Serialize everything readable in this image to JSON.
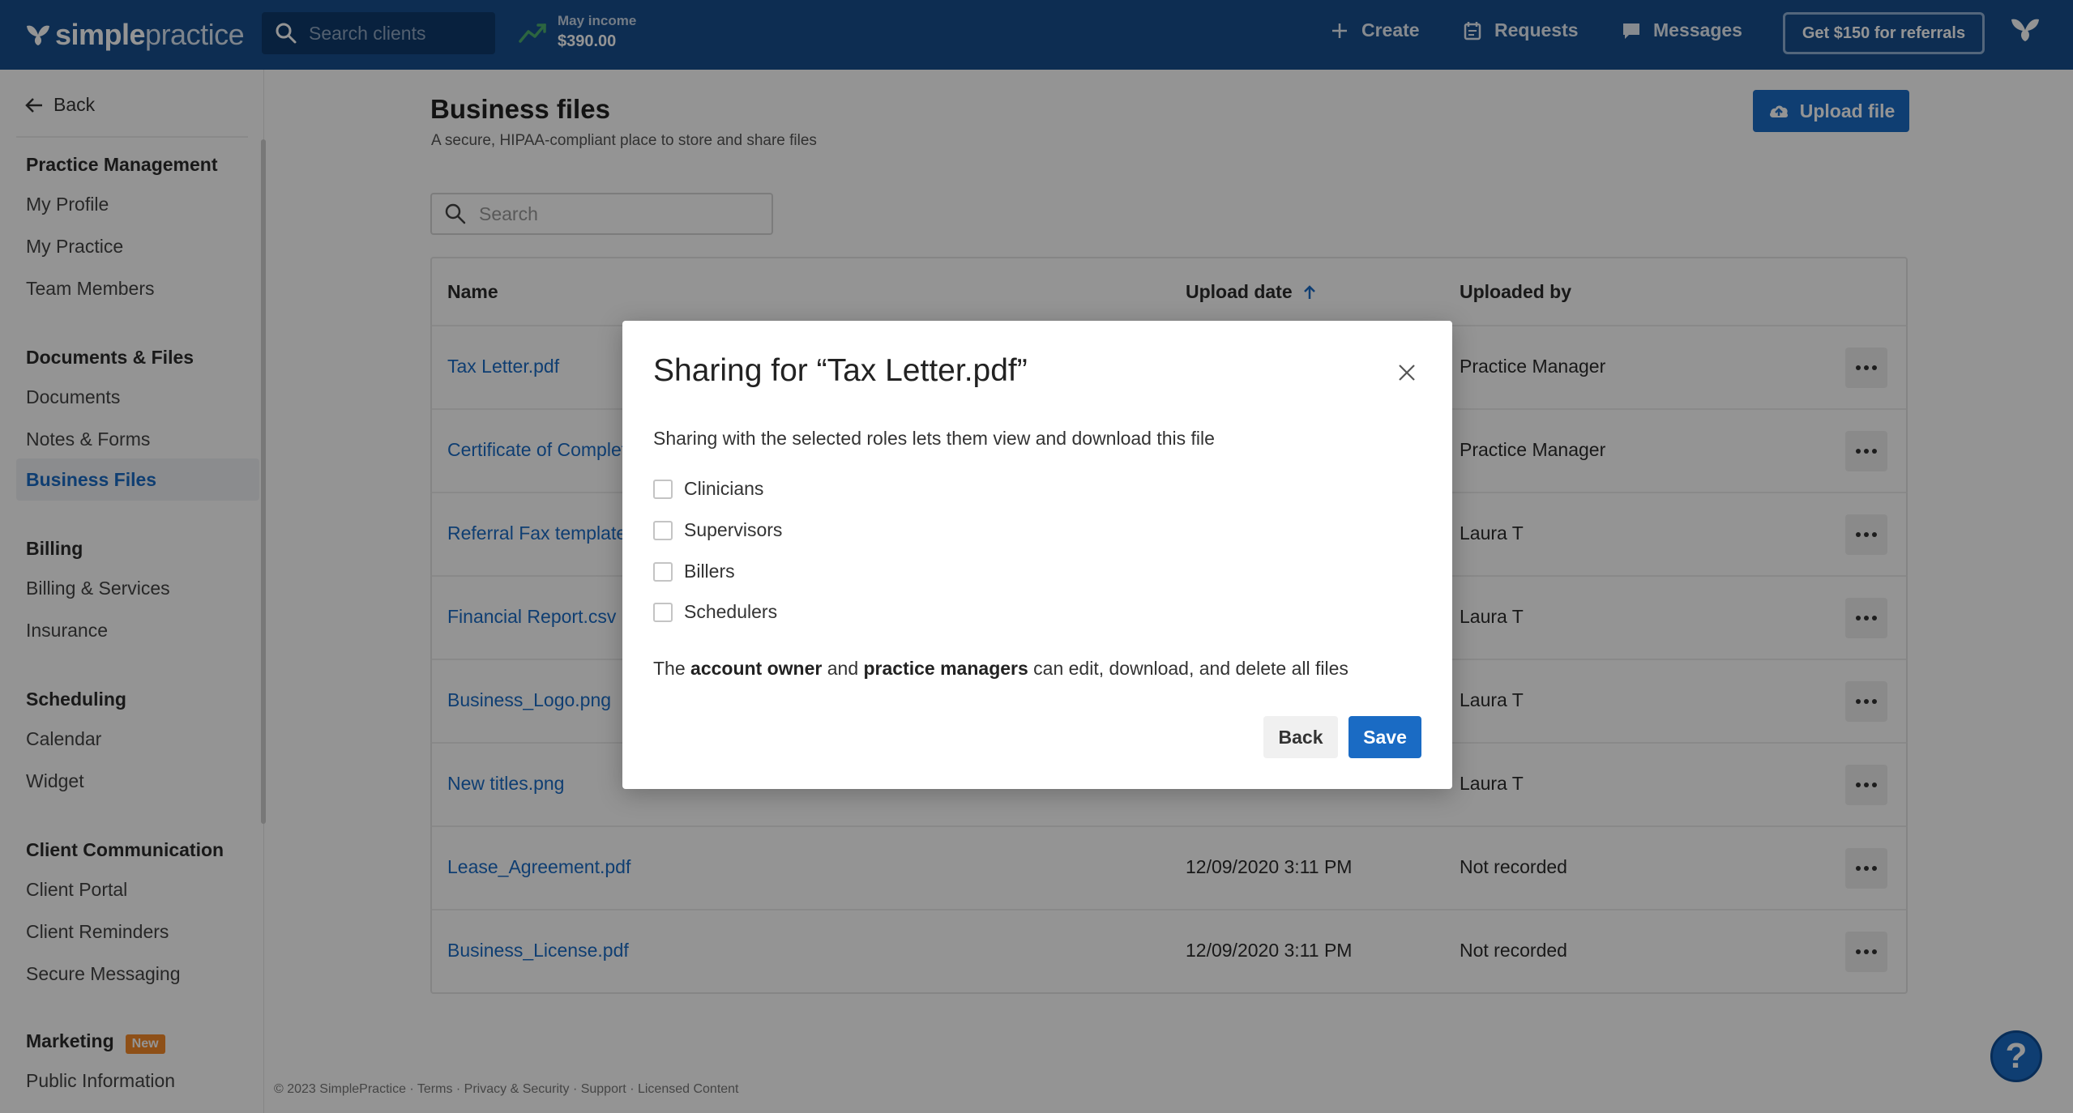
{
  "topbar": {
    "logo_bold": "simple",
    "logo_light": "practice",
    "search_placeholder": "Search clients",
    "income_label": "May income",
    "income_value": "$390.00",
    "create_label": "Create",
    "requests_label": "Requests",
    "messages_label": "Messages",
    "referral_label": "Get $150 for referrals"
  },
  "sidebar": {
    "back_label": "Back",
    "sections": [
      {
        "title": "Practice Management",
        "items": [
          "My Profile",
          "My Practice",
          "Team Members"
        ]
      },
      {
        "title": "Documents & Files",
        "items": [
          "Documents",
          "Notes & Forms",
          "Business Files"
        ]
      },
      {
        "title": "Billing",
        "items": [
          "Billing & Services",
          "Insurance"
        ]
      },
      {
        "title": "Scheduling",
        "items": [
          "Calendar",
          "Widget"
        ]
      },
      {
        "title": "Client Communication",
        "items": [
          "Client Portal",
          "Client Reminders",
          "Secure Messaging"
        ]
      },
      {
        "title": "Marketing",
        "badge": "New",
        "items": [
          "Public Information"
        ]
      }
    ],
    "active_item": "Business Files"
  },
  "main": {
    "title": "Business files",
    "subtitle": "A secure, HIPAA-compliant place to store and share files",
    "upload_label": "Upload file",
    "search_placeholder": "Search",
    "columns": {
      "name": "Name",
      "date": "Upload date",
      "by": "Uploaded by"
    },
    "rows": [
      {
        "name": "Tax Letter.pdf",
        "date": "",
        "by": "Practice Manager"
      },
      {
        "name": "Certificate of Completion.pdf",
        "date": "",
        "by": "Practice Manager"
      },
      {
        "name": "Referral Fax template.docx",
        "date": "",
        "by": "Laura T"
      },
      {
        "name": "Financial Report.csv",
        "date": "",
        "by": "Laura T"
      },
      {
        "name": "Business_Logo.png",
        "date": "",
        "by": "Laura T"
      },
      {
        "name": "New titles.png",
        "date": "",
        "by": "Laura T"
      },
      {
        "name": "Lease_Agreement.pdf",
        "date": "12/09/2020 3:11 PM",
        "by": "Not recorded"
      },
      {
        "name": "Business_License.pdf",
        "date": "12/09/2020 3:11 PM",
        "by": "Not recorded"
      }
    ]
  },
  "footer": {
    "text": "© 2023 SimplePractice · Terms · Privacy & Security · Support · Licensed Content"
  },
  "help": {
    "label": "?"
  },
  "modal": {
    "title": "Sharing for “Tax Letter.pdf”",
    "description": "Sharing with the selected roles lets them view and download this file",
    "roles": [
      "Clinicians",
      "Supervisors",
      "Billers",
      "Schedulers"
    ],
    "note_prefix": "The ",
    "note_owner": "account owner",
    "note_and": " and ",
    "note_managers": "practice managers",
    "note_suffix": " can edit, download, and delete all files",
    "back_label": "Back",
    "save_label": "Save"
  },
  "colors": {
    "brand": "#174f8d",
    "accent": "#1a6bc4",
    "badge": "#f48b2a"
  }
}
